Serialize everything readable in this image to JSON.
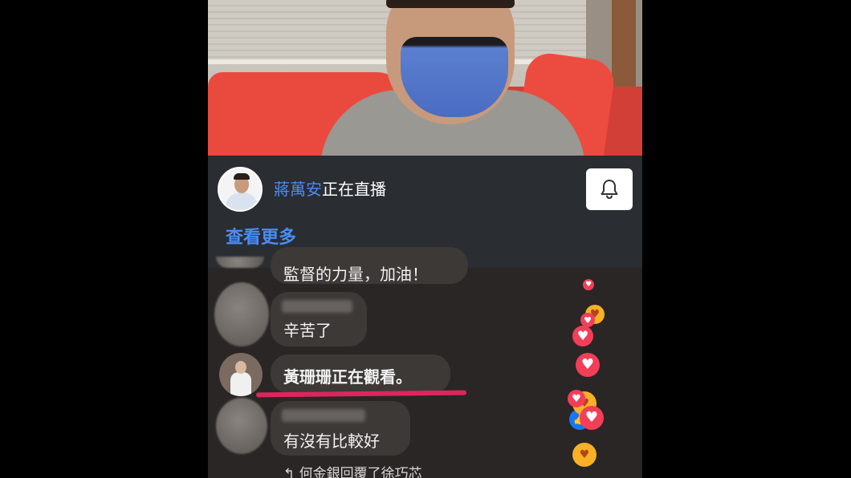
{
  "live_banner": {
    "host_name": "蔣萬安",
    "status_text": "正在直播",
    "see_more_label": "查看更多"
  },
  "comments": {
    "partial_top_text": "監督的力量，加油！",
    "items": [
      {
        "text": "辛苦了"
      },
      {
        "text": "黃珊珊正在觀看。"
      },
      {
        "text": "有沒有比較好"
      }
    ],
    "reply_preview": "何金銀回覆了徐巧芯"
  },
  "colors": {
    "accent_blue": "#4a8cf7",
    "banner_bg": "#2a2d31",
    "heart_red": "#f33e58",
    "highlight_pink": "#e0245e"
  }
}
